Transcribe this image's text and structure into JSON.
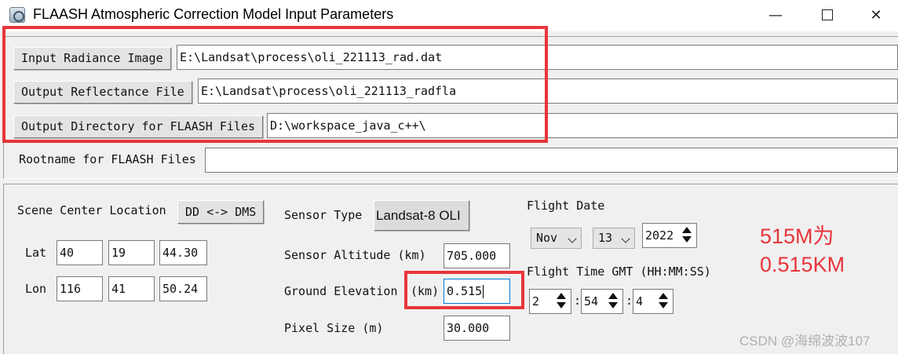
{
  "window": {
    "title": "FLAASH Atmospheric Correction Model Input Parameters",
    "minimize_glyph": "—",
    "close_glyph": "✕"
  },
  "files": {
    "input_radiance_label": "Input Radiance Image",
    "input_radiance_value": "E:\\Landsat\\process\\oli_221113_rad.dat",
    "output_reflectance_label": "Output Reflectance File",
    "output_reflectance_value": "E:\\Landsat\\process\\oli_221113_radfla",
    "output_directory_label": "Output Directory for FLAASH Files",
    "output_directory_value": "D:\\workspace_java_c++\\",
    "rootname_label": "Rootname for FLAASH Files",
    "rootname_value": ""
  },
  "scene": {
    "label": "Scene Center Location",
    "toggle_label": "DD <-> DMS",
    "lat_label": "Lat",
    "lat": [
      "40",
      "19",
      "44.30"
    ],
    "lon_label": "Lon",
    "lon": [
      "116",
      "41",
      "50.24"
    ]
  },
  "sensor": {
    "type_label": "Sensor Type",
    "type_value": "Landsat-8 OLI",
    "altitude_label": "Sensor Altitude (km)",
    "altitude_value": "705.000",
    "ground_label": "Ground Elevation",
    "ground_unit": "(km)",
    "ground_value": "0.515",
    "pixel_label": "Pixel Size (m)",
    "pixel_value": "30.000"
  },
  "flight": {
    "date_label": "Flight Date",
    "month": "Nov",
    "day": "13",
    "year": "2022",
    "time_label": "Flight Time GMT (HH:MM:SS)",
    "hh": "2",
    "mm": "54",
    "ss": "4",
    "separator": ":"
  },
  "annotation": {
    "line1": "515M为",
    "line2": "0.515KM",
    "color": "#e8353b"
  },
  "watermark": "CSDN @海绵波波107"
}
